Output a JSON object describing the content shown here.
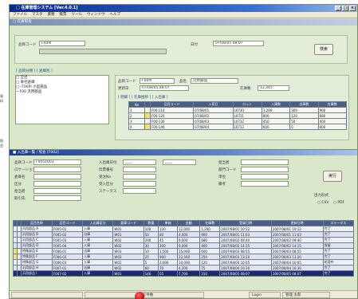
{
  "window": {
    "title": "□ 在庫管理システム [Ver.4.0.1]",
    "menu": [
      "ファイル",
      "マスタ",
      "業務",
      "帳票",
      "ツール",
      "ウィンドウ",
      "ヘルプ"
    ]
  },
  "top_form": {
    "title": "□ 在庫照会",
    "code_label": "品目コード",
    "code_value": "F00PI",
    "name_label": "品名",
    "name_value": "",
    "date_label": "日付",
    "date_value": "07/08/05 08:07",
    "search_button": "検索",
    "tree_tab": "[ 品目分類 ] [ 倉庫別 ]",
    "tree": [
      "□ 全社",
      "  □ 本社倉庫",
      "    □- F00PI 小型部品",
      "      ・F00 汎用部品"
    ],
    "info_code_label": "品目コード",
    "info_code": "F00PI",
    "info_name_label": "品名",
    "info_name": "汎用部品",
    "info_date_label": "更新日",
    "info_date": "07/08/05 08:07",
    "info_qty_label": "在庫数",
    "info_qty": "12,345",
    "grid_tab": "[ 明細 ] [ 在庫推移 ] [ 入出庫 ]",
    "grid_headers": [
      "No",
      "",
      "品目コード",
      "入荷日",
      "ロット",
      "入庫数",
      "出庫数",
      "在庫数"
    ],
    "grid_rows": [
      [
        "1",
        "",
        "F00-110",
        "07/08/01",
        "L0730",
        "1,200",
        "300",
        "900"
      ],
      [
        "2",
        "",
        "F00-120",
        "07/08/02",
        "L0731",
        "800",
        "120",
        "680"
      ],
      [
        "3",
        "",
        "F00-130",
        "07/08/03",
        "L0732",
        "450",
        "50",
        "400"
      ],
      [
        "4",
        "",
        "F00-140",
        "07/08/04",
        "L0733",
        "600",
        "0",
        "600"
      ]
    ]
  },
  "bottom_form": {
    "title": "■ 入出庫一覧 / 照会 [F002]",
    "fields": [
      {
        "label": "品目コード",
        "value": "F0051001"
      },
      {
        "label": "ロケーション",
        "value": ""
      },
      {
        "label": "倉庫名",
        "value": ""
      },
      {
        "label": "区分",
        "value": ""
      },
      {
        "label": "担当者",
        "value": ""
      },
      {
        "label": "取引先",
        "value": ""
      }
    ],
    "mid_fields": [
      {
        "label": "入出庫日付",
        "value": "____",
        "value2": "____"
      },
      {
        "label": "伝票番号",
        "value": ""
      },
      {
        "label": "受注No",
        "value": ""
      },
      {
        "label": "受入区分",
        "value": ""
      },
      {
        "label": "ステータス",
        "value": ""
      }
    ],
    "right_fields": [
      {
        "label": "担当者",
        "value": ""
      },
      {
        "label": "部門コード",
        "value": ""
      },
      {
        "label": "単位",
        "value": ""
      },
      {
        "label": "備考",
        "value": ""
      }
    ],
    "exec_button": "実行",
    "output_label": "出力形式",
    "radio_a": "CSV",
    "radio_b": "PDF",
    "grid_headers": [
      "",
      "",
      "品目名称",
      "品目コード",
      "入出庫区分",
      "倉庫コード",
      "数量",
      "単価",
      "金額",
      "在庫数",
      "登録日時",
      "更新日時",
      "ステータス"
    ],
    "grid_rows": [
      [
        "",
        "",
        "汎用部品 A",
        "F005-01",
        "入庫",
        "W01",
        "100",
        "120",
        "12,000",
        "1,200",
        "2007/08/01 10:12",
        "2007/08/01 10:12",
        "完了"
      ],
      [
        "",
        "",
        "汎用部品 B",
        "F005-02",
        "出庫",
        "W01",
        "50",
        "80",
        "4,000",
        "900",
        "2007/08/01 11:03",
        "2007/08/01 11:03",
        "完了"
      ],
      [
        "",
        "",
        "汎用部品 C",
        "F005-03",
        "入庫",
        "W02",
        "200",
        "45",
        "9,000",
        "680",
        "2007/08/02 09:40",
        "2007/08/02 09:40",
        "完了"
      ],
      [
        "",
        "",
        "汎用部品 D",
        "F005-04",
        "入庫",
        "W02",
        "30",
        "300",
        "9,000",
        "400",
        "2007/08/02 14:15",
        "2007/08/02 14:15",
        "保留"
      ],
      [
        "",
        "",
        "特殊部品 E",
        "F006-01",
        "出庫",
        "W03",
        "10",
        "1,500",
        "15,000",
        "600",
        "2007/08/03 08:55",
        "2007/08/03 08:55",
        "完了"
      ],
      [
        "",
        "",
        "特殊部品 F",
        "F006-02",
        "入庫",
        "W03",
        "25",
        "900",
        "22,500",
        "250",
        "2007/08/03 13:20",
        "2007/08/03 13:20",
        "完了"
      ],
      [
        "",
        "",
        "特殊部品 G",
        "F006-03",
        "入庫",
        "W01",
        "5",
        "2,000",
        "10,000",
        "120",
        "2007/08/04 10:05",
        "2007/08/04 10:05",
        "処理中"
      ],
      [
        "",
        "",
        "汎用部品 H",
        "F007-01",
        "出庫",
        "W02",
        "60",
        "70",
        "4,200",
        "75",
        "2007/08/04 16:30",
        "2007/08/04 16:30",
        "完了"
      ],
      [
        "",
        "",
        "汎用部品 I",
        "F007-02",
        "入庫",
        "W01",
        "140",
        "55",
        "7,700",
        "310",
        "2007/08/05 08:07",
        "2007/08/05 08:07",
        "完了"
      ]
    ]
  },
  "statusbar": {
    "left": "",
    "center": "データ件数",
    "right1": "Login",
    "right2": "管理 太郎"
  },
  "side_text": [
    "資",
    "料",
    "",
    "照",
    "会"
  ]
}
